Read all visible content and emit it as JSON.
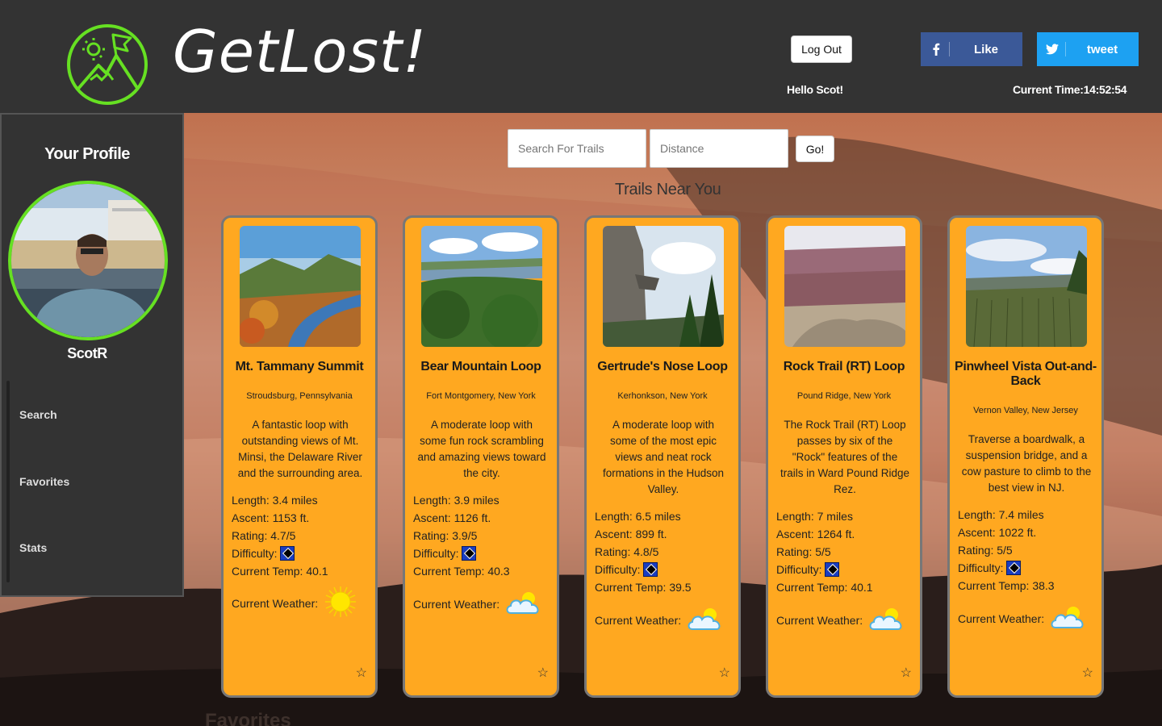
{
  "header": {
    "brand": "GetLost!",
    "logout_label": "Log Out",
    "greeting": "Hello Scot!",
    "like_label": "Like",
    "tweet_label": "tweet",
    "time": "Current Time:14:52:54",
    "brand_color": "#66e022"
  },
  "sidebar": {
    "title": "Your Profile",
    "username": "ScotR",
    "nav": [
      {
        "label": "Search"
      },
      {
        "label": "Favorites"
      },
      {
        "label": "Stats"
      }
    ]
  },
  "search": {
    "trail_placeholder": "Search For Trails",
    "distance_placeholder": "Distance",
    "go_label": "Go!"
  },
  "main": {
    "section_title": "Trails Near You",
    "favorites_title": "Favorites",
    "weather_label": "Current Weather:",
    "difficulty_label": "Difficulty:"
  },
  "trails": [
    {
      "name": "Mt. Tammany Summit",
      "location": "Stroudsburg, Pennsylvania",
      "description": "A fantastic loop with outstanding views of Mt. Minsi, the Delaware River and the surrounding area.",
      "length": "Length: 3.4 miles",
      "ascent": "Ascent: 1153 ft.",
      "rating": "Rating: 4.7/5",
      "temp": "Current Temp: 40.1",
      "weather": "sun-icon"
    },
    {
      "name": "Bear Mountain Loop",
      "location": "Fort Montgomery, New York",
      "description": "A moderate loop with some fun rock scrambling and amazing views toward the city.",
      "length": "Length: 3.9 miles",
      "ascent": "Ascent: 1126 ft.",
      "rating": "Rating: 3.9/5",
      "temp": "Current Temp: 40.3",
      "weather": "partly-cloudy-icon"
    },
    {
      "name": "Gertrude's Nose Loop",
      "location": "Kerhonkson, New York",
      "description": "A moderate loop with some of the most epic views and neat rock formations in the Hudson Valley.",
      "length": "Length: 6.5 miles",
      "ascent": "Ascent: 899 ft.",
      "rating": "Rating: 4.8/5",
      "temp": "Current Temp: 39.5",
      "weather": "partly-cloudy-icon"
    },
    {
      "name": "Rock Trail (RT) Loop",
      "location": "Pound Ridge, New York",
      "description": "The Rock Trail (RT) Loop passes by six of the \"Rock\" features of the trails in Ward Pound Ridge Rez.",
      "length": "Length: 7 miles",
      "ascent": "Ascent: 1264 ft.",
      "rating": "Rating: 5/5",
      "temp": "Current Temp: 40.1",
      "weather": "partly-cloudy-icon"
    },
    {
      "name": "Pinwheel Vista Out-and-Back",
      "location": "Vernon Valley, New Jersey",
      "description": "Traverse a boardwalk, a suspension bridge, and a cow pasture to climb to the best view in NJ.",
      "length": "Length: 7.4 miles",
      "ascent": "Ascent: 1022 ft.",
      "rating": "Rating: 5/5",
      "temp": "Current Temp: 38.3",
      "weather": "partly-cloudy-icon"
    }
  ],
  "colors": {
    "card": "#ffa820",
    "facebook": "#3b5998",
    "twitter": "#1da1f2"
  }
}
